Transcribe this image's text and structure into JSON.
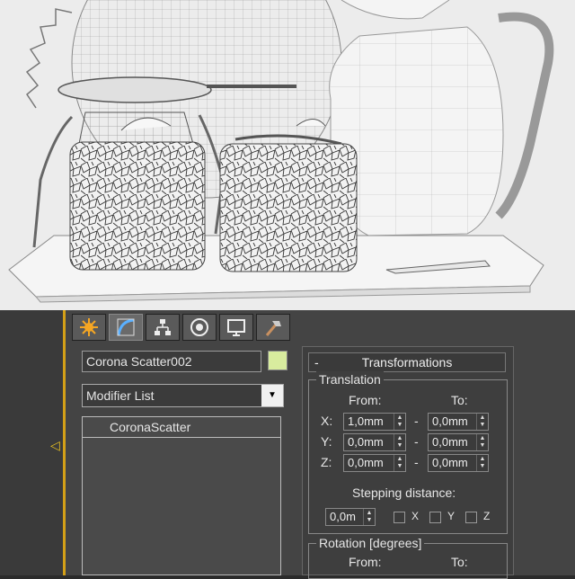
{
  "tabs": [
    {
      "name": "create-tab",
      "icon": "sun-burst-icon"
    },
    {
      "name": "modify-tab",
      "icon": "modify-curve-icon"
    },
    {
      "name": "hierarchy-tab",
      "icon": "hierarchy-icon"
    },
    {
      "name": "motion-tab",
      "icon": "motion-circle-icon"
    },
    {
      "name": "display-tab",
      "icon": "display-monitor-icon"
    },
    {
      "name": "utilities-tab",
      "icon": "hammer-icon"
    }
  ],
  "object_name": "Corona Scatter002",
  "object_color": "#d8ec9e",
  "modifier_list_label": "Modifier List",
  "stack_items": [
    "CoronaScatter"
  ],
  "transformations": {
    "collapse_symbol": "-",
    "title": "Transformations",
    "translation": {
      "label": "Translation",
      "from_label": "From:",
      "to_label": "To:",
      "rows": [
        {
          "axis": "X:",
          "from": "1,0mm",
          "to": "0,0mm"
        },
        {
          "axis": "Y:",
          "from": "0,0mm",
          "to": "0,0mm"
        },
        {
          "axis": "Z:",
          "from": "0,0mm",
          "to": "0,0mm"
        }
      ],
      "dash": "-",
      "stepping_label": "Stepping distance:",
      "stepping_value": "0,0m",
      "checks": [
        "X",
        "Y",
        "Z"
      ]
    },
    "rotation": {
      "label": "Rotation [degrees]",
      "from_label": "From:",
      "to_label": "To:"
    }
  },
  "colors": {
    "accent": "#d4a017",
    "panel": "#444444"
  }
}
